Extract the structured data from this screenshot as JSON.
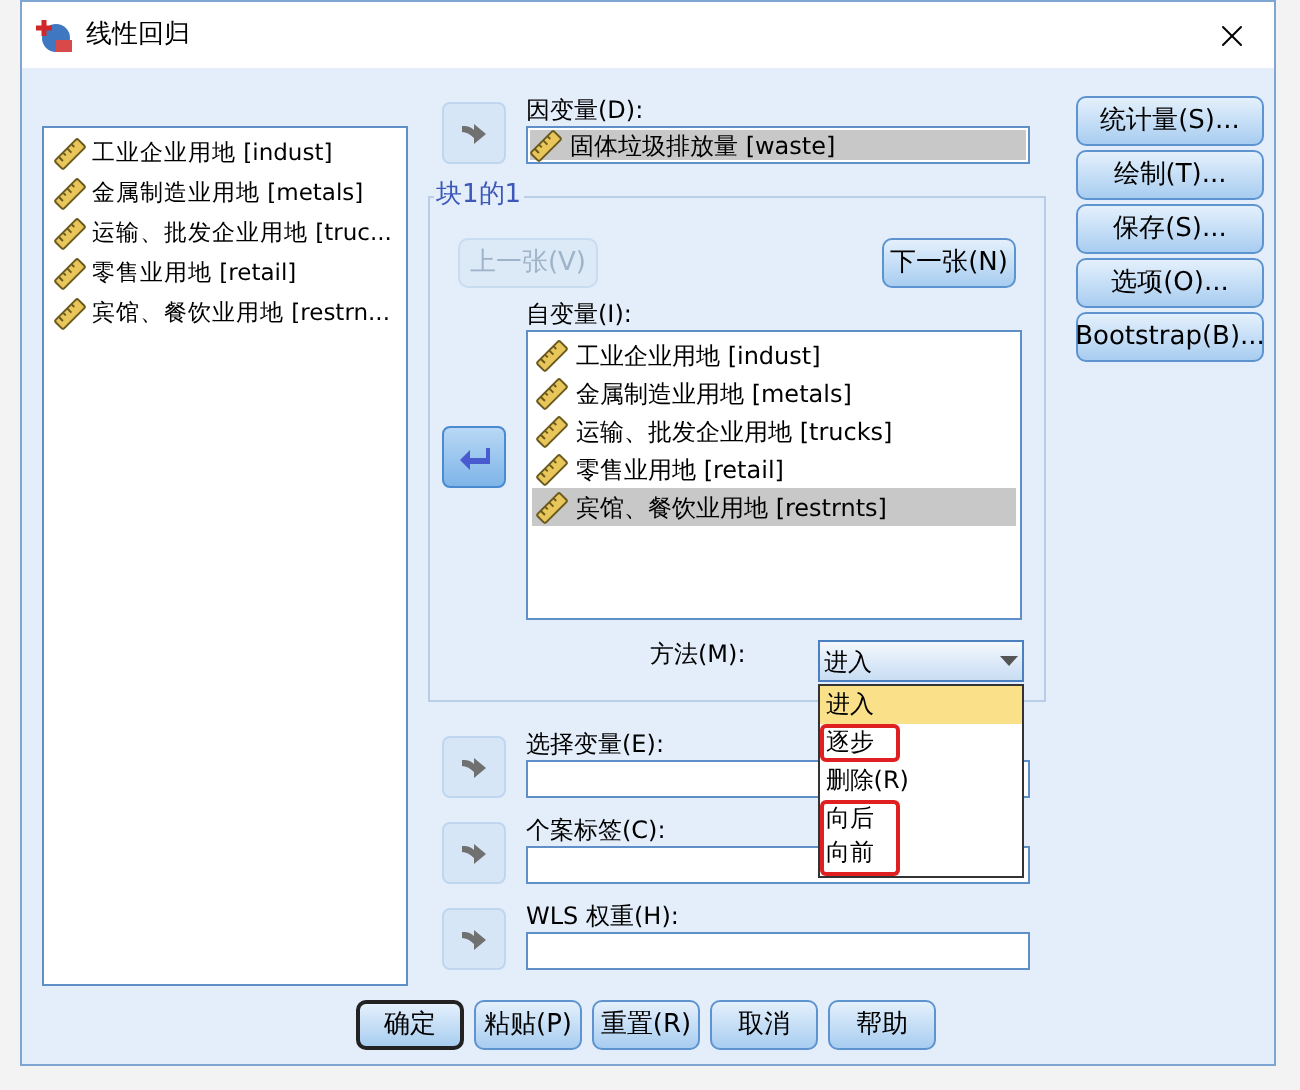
{
  "window": {
    "title": "线性回归"
  },
  "variables": [
    {
      "label": "工业企业用地 [indust]"
    },
    {
      "label": "金属制造业用地 [metals]"
    },
    {
      "label": "运输、批发企业用地 [truc..."
    },
    {
      "label": "零售业用地 [retail]"
    },
    {
      "label": "宾馆、餐饮业用地 [restrn..."
    }
  ],
  "dependent": {
    "label": "因变量(D):",
    "arrow_active": false,
    "items": [
      {
        "label": "固体垃圾排放量 [waste]",
        "selected": true
      }
    ]
  },
  "block": {
    "legend": "块1的1",
    "prev": {
      "label": "上一张(V)",
      "disabled": true
    },
    "next": {
      "label": "下一张(N)",
      "disabled": false
    },
    "independent": {
      "label": "自变量(I):",
      "arrow_active": true,
      "items": [
        {
          "label": "工业企业用地 [indust]",
          "selected": false
        },
        {
          "label": "金属制造业用地 [metals]",
          "selected": false
        },
        {
          "label": "运输、批发企业用地 [trucks]",
          "selected": false
        },
        {
          "label": "零售业用地 [retail]",
          "selected": false
        },
        {
          "label": "宾馆、餐饮业用地 [restrnts]",
          "selected": true
        }
      ]
    },
    "method": {
      "label": "方法(M):",
      "value": "进入",
      "expanded": true,
      "options": [
        {
          "label": "进入",
          "selected": true,
          "marked": false
        },
        {
          "label": "逐步",
          "selected": false,
          "marked": true
        },
        {
          "label": "删除(R)",
          "selected": false,
          "marked": false
        },
        {
          "label": "向后",
          "selected": false,
          "marked": true
        },
        {
          "label": "向前",
          "selected": false,
          "marked": true
        }
      ]
    }
  },
  "fields": [
    {
      "label": "选择变量(E):",
      "arrow_active": false
    },
    {
      "label": "个案标签(C):",
      "arrow_active": false
    },
    {
      "label": "WLS 权重(H):",
      "arrow_active": false
    }
  ],
  "side_buttons": [
    {
      "label": "统计量(S)..."
    },
    {
      "label": "绘制(T)..."
    },
    {
      "label": "保存(S)..."
    },
    {
      "label": "选项(O)..."
    },
    {
      "label": "Bootstrap(B)..."
    }
  ],
  "footer_buttons": [
    {
      "label": "确定",
      "default": true
    },
    {
      "label": "粘贴(P)",
      "default": false
    },
    {
      "label": "重置(R)",
      "default": false
    },
    {
      "label": "取消",
      "default": false
    },
    {
      "label": "帮助",
      "default": false
    }
  ]
}
